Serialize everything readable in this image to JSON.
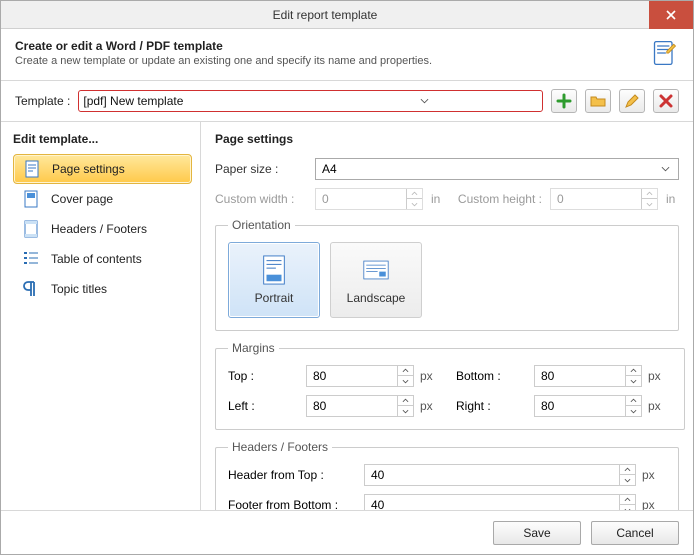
{
  "window": {
    "title": "Edit report template"
  },
  "header": {
    "title": "Create or edit a Word / PDF template",
    "subtitle": "Create a new template or update an existing one and specify its name and properties."
  },
  "template_row": {
    "label": "Template :",
    "value": "[pdf] New template"
  },
  "sidebar": {
    "title": "Edit template...",
    "items": [
      {
        "label": "Page settings"
      },
      {
        "label": "Cover page"
      },
      {
        "label": "Headers / Footers"
      },
      {
        "label": "Table of contents"
      },
      {
        "label": "Topic titles"
      }
    ]
  },
  "page_settings": {
    "title": "Page settings",
    "paper_size": {
      "label": "Paper size :",
      "value": "A4"
    },
    "custom": {
      "width_label": "Custom width :",
      "width_value": "0",
      "width_unit": "in",
      "height_label": "Custom height :",
      "height_value": "0",
      "height_unit": "in"
    },
    "orientation": {
      "legend": "Orientation",
      "portrait": "Portrait",
      "landscape": "Landscape"
    },
    "margins": {
      "legend": "Margins",
      "top_label": "Top :",
      "top_value": "80",
      "bottom_label": "Bottom :",
      "bottom_value": "80",
      "left_label": "Left :",
      "left_value": "80",
      "right_label": "Right :",
      "right_value": "80",
      "unit": "px"
    },
    "hf": {
      "legend": "Headers / Footers",
      "header_label": "Header from Top :",
      "header_value": "40",
      "footer_label": "Footer from Bottom :",
      "footer_value": "40",
      "unit": "px"
    }
  },
  "footer": {
    "save": "Save",
    "cancel": "Cancel"
  }
}
